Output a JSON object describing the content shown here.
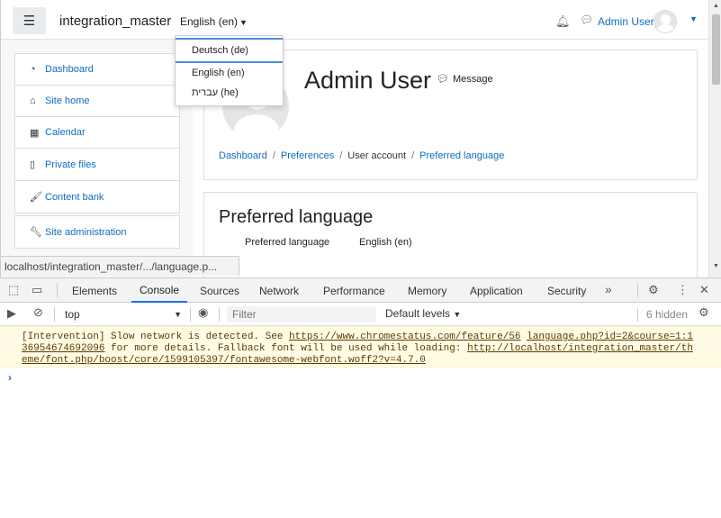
{
  "topbar": {
    "brand": "integration_master",
    "language": "English (en)",
    "user_name": "Admin User"
  },
  "language_menu": [
    {
      "label": "Deutsch (de)"
    },
    {
      "label": "English (en)"
    },
    {
      "label": "עברית (he)"
    }
  ],
  "nav": {
    "items": [
      {
        "label": "Dashboard",
        "icon": "dashboard-icon"
      },
      {
        "label": "Site home",
        "icon": "home-icon"
      },
      {
        "label": "Calendar",
        "icon": "calendar-icon"
      },
      {
        "label": "Private files",
        "icon": "file-icon"
      },
      {
        "label": "Content bank",
        "icon": "paint-brush-icon"
      },
      {
        "label": "Site administration",
        "icon": "wrench-icon"
      }
    ]
  },
  "profile": {
    "name": "Admin User",
    "message_label": "Message",
    "breadcrumb": [
      "Dashboard",
      "Preferences",
      "User account",
      "Preferred language"
    ]
  },
  "preferred": {
    "heading": "Preferred language",
    "field_label": "Preferred language",
    "field_value": "English (en)"
  },
  "status_url": "localhost/integration_master/.../language.p...",
  "devtools": {
    "tabs": [
      "Elements",
      "Console",
      "Sources",
      "Network",
      "Performance",
      "Memory",
      "Application",
      "Security"
    ],
    "active_tab": "Console",
    "context": "top",
    "filter_placeholder": "Filter",
    "levels": "Default levels",
    "hidden": "6 hidden",
    "warning": {
      "prefix": "[Intervention] Slow network is detected. See ",
      "link1": "https://www.chromestatus.com/feature/56",
      "link2": "language.php?id=2&course=1:1",
      "link1b": "36954674692096",
      "middle": " for more details. Fallback font will be used while loading: ",
      "link3": "http://localhost/integration_master/th",
      "link3b": "eme/font.php/boost/core/1599105397/fontawesome-webfont.woff2?v=4.7.0"
    }
  }
}
